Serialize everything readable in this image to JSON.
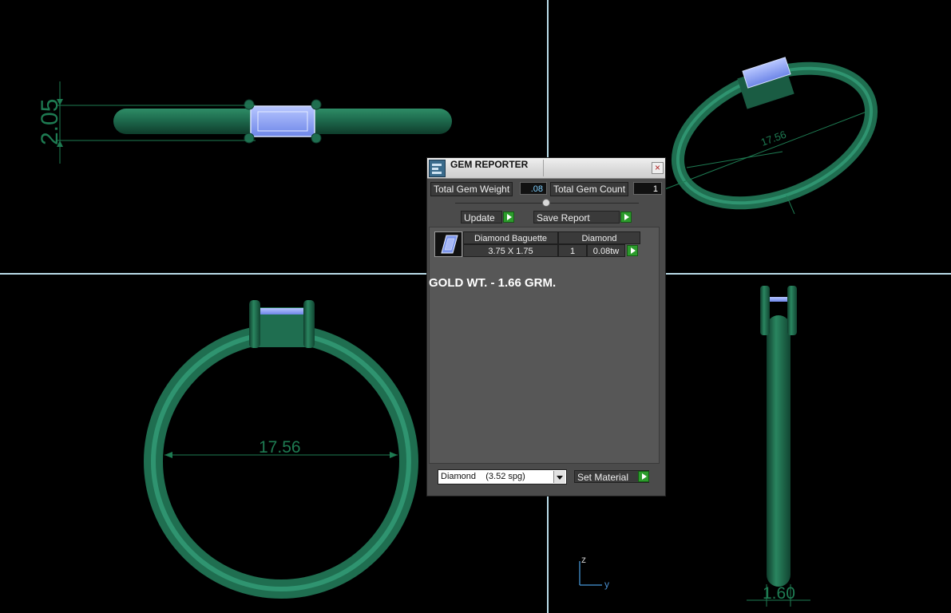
{
  "viewport": {
    "top_left_dimension": "2.05",
    "top_right_dimension": "17.56",
    "bottom_left_dimension": "17.56",
    "bottom_right_dimension": "1.60",
    "axis_z_label": "z",
    "axis_y_label": "y"
  },
  "gem_reporter": {
    "title": "GEM REPORTER",
    "close_label": "×",
    "total_gem_weight_label": "Total Gem Weight",
    "total_gem_weight_value": ".08",
    "total_gem_count_label": "Total Gem Count",
    "total_gem_count_value": "1",
    "update_label": "Update",
    "save_report_label": "Save Report",
    "gems": [
      {
        "cut": "Diamond Baguette",
        "material": "Diamond",
        "size": "3.75 X 1.75",
        "count": "1",
        "weight": "0.08tw"
      }
    ],
    "gold_weight_text": "GOLD WT. - 1.66 GRM.",
    "material_select_value": "Diamond    (3.52 spg)",
    "set_material_label": "Set Material"
  },
  "colors": {
    "metal": "#1f6e50",
    "gem": "#8a9ef0",
    "viewport_divider": "#b9dbe8",
    "panel_bg": "#4b4b4b"
  },
  "icons": {
    "title": "gem-reporter-icon",
    "close": "close-icon",
    "arrow": "play-arrow-icon",
    "thumb": "gem-thumbnail-icon",
    "dropdown": "chevron-down-icon"
  }
}
